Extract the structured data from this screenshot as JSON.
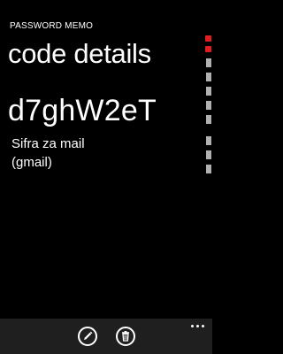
{
  "header": {
    "app_title": "PASSWORD MEMO",
    "page_title": "code details"
  },
  "code": {
    "value": "d7ghW2eT",
    "description_line1": "Sifra za mail",
    "description_line2": "(gmail)"
  },
  "app_bar": {
    "buttons": [
      {
        "icon": "edit-icon"
      },
      {
        "icon": "delete-icon"
      }
    ],
    "menu_icon": "more-dots-icon"
  },
  "colors": {
    "background": "#000000",
    "text": "#ffffff",
    "app_bar": "#1f1f1f",
    "accent": "#e01e1e"
  }
}
